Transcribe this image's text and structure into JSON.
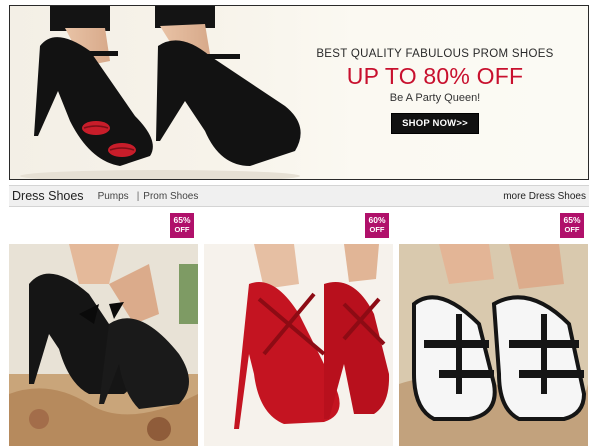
{
  "banner": {
    "subtitle": "BEST QUALITY FABULOUS PROM SHOES",
    "headline": "UP TO 80% OFF",
    "tagline": "Be A Party Queen!",
    "cta_label": "SHOP NOW>>"
  },
  "category_bar": {
    "title": "Dress Shoes",
    "links": [
      "Pumps",
      "Prom Shoes"
    ],
    "separator": "|",
    "more_label": "more Dress Shoes"
  },
  "products": [
    {
      "discount": "65%",
      "off": "OFF",
      "image": "black-bow-platform-heels"
    },
    {
      "discount": "60%",
      "off": "OFF",
      "image": "red-strappy-pumps"
    },
    {
      "discount": "65%",
      "off": "OFF",
      "image": "black-white-tstrap-platform-heels"
    }
  ],
  "colors": {
    "headline": "#c8102e",
    "badge": "#b0106a",
    "cta_background": "#111111"
  }
}
